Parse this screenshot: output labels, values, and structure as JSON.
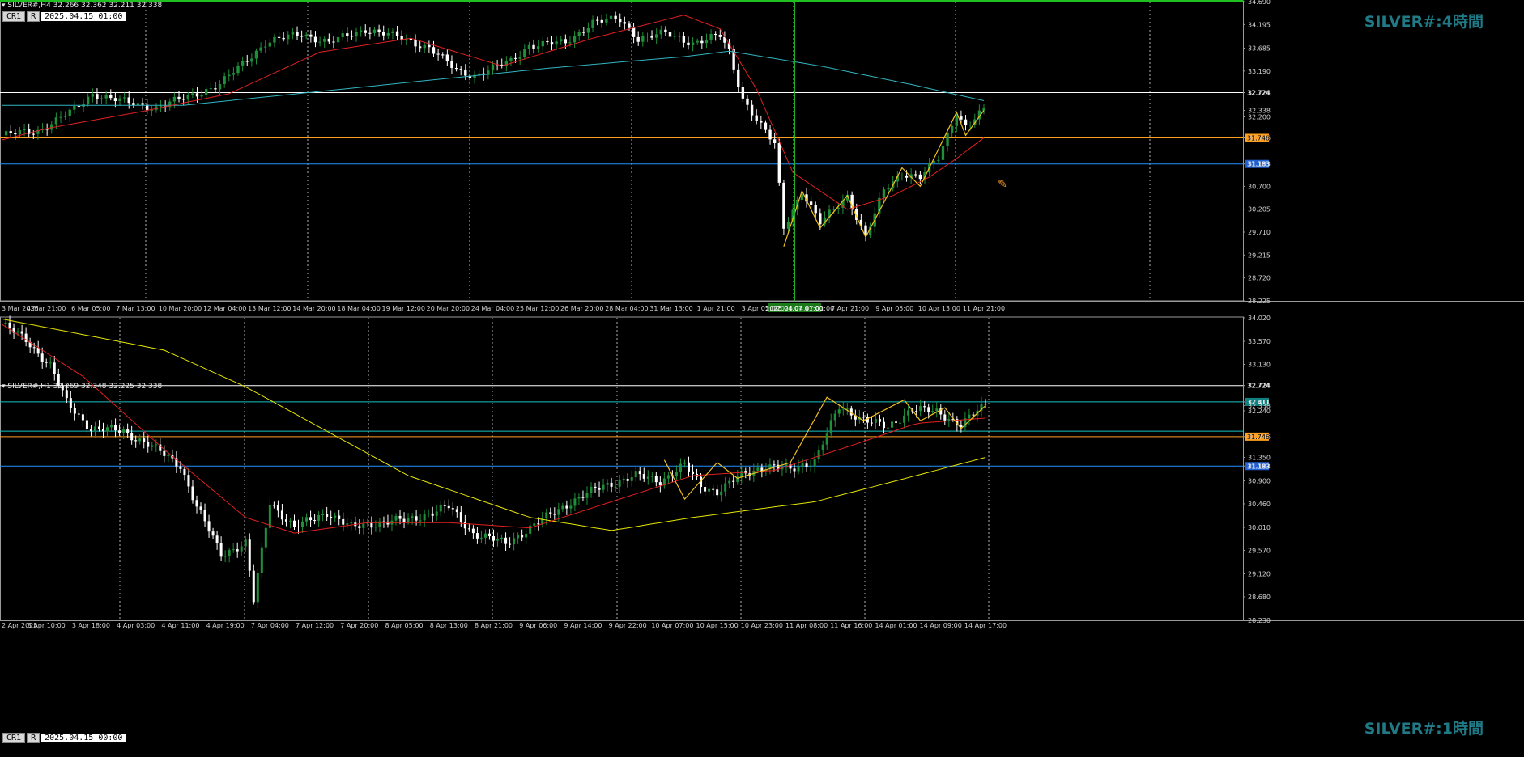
{
  "colors": {
    "bull": "#1f8f3a",
    "bear": "#ffffff",
    "ma_fast": "#e02020",
    "ma_slow": "#32b4c0",
    "ma_slow_h1": "#e6e600",
    "zigzag": "#f0c020",
    "line_white": "#ffffff",
    "line_orange": "#ffa020",
    "line_blue": "#2090ff",
    "line_teal": "#18c0c0",
    "vline": "#20b020",
    "tag_orange_bg": "#ffa020",
    "tag_blue_bg": "#2060d0"
  },
  "panels": [
    {
      "id": "h4",
      "symbol_label": "SILVER#,H4",
      "ohlc": "32.266 32.362 32.211 32.338",
      "watermark": "SILVER#:4時間",
      "buttons": [
        "CR1",
        "R"
      ],
      "datetime": "2025.04.15 01:00",
      "price_range": [
        28.225,
        34.69
      ],
      "price_ticks": [
        "34.690",
        "34.195",
        "33.685",
        "33.190",
        "32.724",
        "32.338",
        "32.200",
        "31.746",
        "31.183",
        "30.700",
        "30.205",
        "29.710",
        "29.215",
        "28.720",
        "28.225"
      ],
      "time_labels": [
        "3 Mar 2025",
        "4 Mar 21:00",
        "6 Mar 05:00",
        "7 Mar 13:00",
        "10 Mar 20:00",
        "12 Mar 04:00",
        "13 Mar 12:00",
        "14 Mar 20:00",
        "18 Mar 04:00",
        "19 Mar 12:00",
        "20 Mar 20:00",
        "24 Mar 04:00",
        "25 Mar 12:00",
        "26 Mar 20:00",
        "28 Mar 04:00",
        "31 Mar 13:00",
        "1 Apr 21:00",
        "3 Apr 05:00",
        "2025.04.07 01:00",
        "7 Apr 21:00",
        "9 Apr 05:00",
        "10 Apr 13:00",
        "11 Apr 21:00"
      ],
      "hlines": [
        {
          "price": 32.724,
          "tag": "32.724",
          "color": "line_white"
        },
        {
          "price": 31.746,
          "tag": "31.746",
          "color": "line_orange"
        },
        {
          "price": 31.183,
          "tag": "31.183",
          "color": "line_blue"
        }
      ],
      "vline_label": "2025.04.07 01:00",
      "chart_data": {
        "type": "candlestick",
        "timeframe": "H4",
        "close_path": [
          [
            0,
            31.8
          ],
          [
            8,
            31.9
          ],
          [
            16,
            32.35
          ],
          [
            20,
            32.7
          ],
          [
            28,
            32.5
          ],
          [
            34,
            32.4
          ],
          [
            40,
            32.6
          ],
          [
            48,
            32.9
          ],
          [
            58,
            33.8
          ],
          [
            66,
            34.0
          ],
          [
            72,
            33.8
          ],
          [
            80,
            34.1
          ],
          [
            88,
            33.9
          ],
          [
            94,
            33.7
          ],
          [
            100,
            33.2
          ],
          [
            104,
            33.1
          ],
          [
            112,
            33.4
          ],
          [
            116,
            33.75
          ],
          [
            124,
            33.8
          ],
          [
            130,
            34.25
          ],
          [
            136,
            34.3
          ],
          [
            140,
            33.9
          ],
          [
            146,
            34.0
          ],
          [
            152,
            33.8
          ],
          [
            158,
            33.95
          ],
          [
            160,
            33.6
          ],
          [
            163,
            32.6
          ],
          [
            167,
            32.0
          ],
          [
            170,
            31.6
          ],
          [
            172,
            29.8
          ],
          [
            176,
            30.6
          ],
          [
            180,
            29.9
          ],
          [
            184,
            30.3
          ],
          [
            186,
            30.5
          ],
          [
            190,
            29.6
          ],
          [
            194,
            30.6
          ],
          [
            198,
            31.0
          ],
          [
            202,
            30.9
          ],
          [
            206,
            31.3
          ],
          [
            210,
            32.3
          ],
          [
            212,
            32.0
          ],
          [
            216,
            32.34
          ]
        ],
        "ma_fast": [
          [
            0,
            31.7
          ],
          [
            10,
            31.95
          ],
          [
            30,
            32.3
          ],
          [
            50,
            32.7
          ],
          [
            70,
            33.6
          ],
          [
            90,
            33.9
          ],
          [
            110,
            33.3
          ],
          [
            130,
            33.9
          ],
          [
            150,
            34.4
          ],
          [
            158,
            34.1
          ],
          [
            166,
            32.8
          ],
          [
            174,
            31.0
          ],
          [
            186,
            30.2
          ],
          [
            196,
            30.5
          ],
          [
            204,
            30.9
          ],
          [
            210,
            31.3
          ],
          [
            216,
            31.75
          ]
        ],
        "ma_slow": [
          [
            0,
            32.45
          ],
          [
            40,
            32.45
          ],
          [
            80,
            32.85
          ],
          [
            120,
            33.25
          ],
          [
            150,
            33.5
          ],
          [
            160,
            33.62
          ],
          [
            180,
            33.3
          ],
          [
            200,
            32.9
          ],
          [
            216,
            32.55
          ]
        ],
        "zigzag": [
          [
            172,
            29.4
          ],
          [
            176,
            30.6
          ],
          [
            180,
            29.8
          ],
          [
            186,
            30.5
          ],
          [
            190,
            29.6
          ],
          [
            198,
            31.1
          ],
          [
            202,
            30.7
          ],
          [
            210,
            32.3
          ],
          [
            212,
            31.8
          ],
          [
            216,
            32.34
          ]
        ]
      }
    },
    {
      "id": "h1",
      "symbol_label": "SILVER#,H1",
      "ohlc": "32.269 32.348 32.225 32.338",
      "watermark": "SILVER#:1時間",
      "buttons": [
        "CR1",
        "R"
      ],
      "datetime": "2025.04.15 00:00",
      "price_range": [
        28.23,
        34.02
      ],
      "price_ticks": [
        "34.020",
        "33.570",
        "33.130",
        "32.724",
        "32.411",
        "32.338",
        "32.240",
        "31.746",
        "31.350",
        "31.183",
        "30.900",
        "30.460",
        "30.010",
        "29.570",
        "29.120",
        "28.680",
        "28.230"
      ],
      "time_labels": [
        "2 Apr 2025",
        "3 Apr 10:00",
        "3 Apr 18:00",
        "4 Apr 03:00",
        "4 Apr 11:00",
        "4 Apr 19:00",
        "7 Apr 04:00",
        "7 Apr 12:00",
        "7 Apr 20:00",
        "8 Apr 05:00",
        "8 Apr 13:00",
        "8 Apr 21:00",
        "9 Apr 06:00",
        "9 Apr 14:00",
        "9 Apr 22:00",
        "10 Apr 07:00",
        "10 Apr 15:00",
        "10 Apr 23:00",
        "11 Apr 08:00",
        "11 Apr 16:00",
        "14 Apr 01:00",
        "14 Apr 09:00",
        "14 Apr 17:00"
      ],
      "hlines": [
        {
          "price": 32.724,
          "tag": "32.724",
          "color": "line_white"
        },
        {
          "price": 32.411,
          "tag": "32.411",
          "color": "line_teal"
        },
        {
          "price": 31.85,
          "tag": "",
          "color": "line_teal"
        },
        {
          "price": 31.746,
          "tag": "31.746",
          "color": "line_orange"
        },
        {
          "price": 31.183,
          "tag": "31.183",
          "color": "line_blue"
        }
      ],
      "chart_data": {
        "type": "candlestick",
        "timeframe": "H1",
        "close_path": [
          [
            0,
            33.9
          ],
          [
            6,
            33.6
          ],
          [
            12,
            33.1
          ],
          [
            16,
            32.4
          ],
          [
            22,
            31.9
          ],
          [
            30,
            31.85
          ],
          [
            36,
            31.6
          ],
          [
            44,
            31.2
          ],
          [
            48,
            30.4
          ],
          [
            54,
            29.5
          ],
          [
            60,
            29.7
          ],
          [
            62,
            28.6
          ],
          [
            66,
            30.5
          ],
          [
            72,
            30.0
          ],
          [
            80,
            30.3
          ],
          [
            86,
            30.0
          ],
          [
            92,
            30.1
          ],
          [
            100,
            30.15
          ],
          [
            110,
            30.4
          ],
          [
            116,
            29.9
          ],
          [
            124,
            29.7
          ],
          [
            132,
            30.1
          ],
          [
            140,
            30.5
          ],
          [
            148,
            30.8
          ],
          [
            156,
            31.0
          ],
          [
            162,
            30.9
          ],
          [
            168,
            31.2
          ],
          [
            172,
            30.8
          ],
          [
            176,
            30.7
          ],
          [
            182,
            31.0
          ],
          [
            188,
            31.2
          ],
          [
            194,
            31.1
          ],
          [
            200,
            31.3
          ],
          [
            206,
            32.3
          ],
          [
            212,
            32.1
          ],
          [
            218,
            31.9
          ],
          [
            224,
            32.3
          ],
          [
            230,
            32.2
          ],
          [
            236,
            32.0
          ],
          [
            242,
            32.34
          ]
        ],
        "ma_fast": [
          [
            0,
            33.9
          ],
          [
            20,
            32.9
          ],
          [
            40,
            31.5
          ],
          [
            60,
            30.2
          ],
          [
            72,
            29.9
          ],
          [
            90,
            30.1
          ],
          [
            110,
            30.1
          ],
          [
            130,
            30.0
          ],
          [
            150,
            30.5
          ],
          [
            170,
            31.0
          ],
          [
            190,
            31.1
          ],
          [
            210,
            31.6
          ],
          [
            225,
            32.0
          ],
          [
            242,
            32.1
          ]
        ],
        "ma_slow": [
          [
            0,
            34.0
          ],
          [
            40,
            33.4
          ],
          [
            60,
            32.7
          ],
          [
            100,
            31.0
          ],
          [
            130,
            30.2
          ],
          [
            150,
            29.95
          ],
          [
            170,
            30.2
          ],
          [
            200,
            30.5
          ],
          [
            220,
            30.9
          ],
          [
            242,
            31.35
          ]
        ],
        "zigzag": [
          [
            163,
            31.3
          ],
          [
            168,
            30.55
          ],
          [
            176,
            31.25
          ],
          [
            181,
            30.95
          ],
          [
            194,
            31.25
          ],
          [
            203,
            32.5
          ],
          [
            212,
            32.05
          ],
          [
            222,
            32.45
          ],
          [
            226,
            32.05
          ],
          [
            232,
            32.3
          ],
          [
            236,
            31.9
          ],
          [
            242,
            32.34
          ]
        ]
      }
    }
  ]
}
